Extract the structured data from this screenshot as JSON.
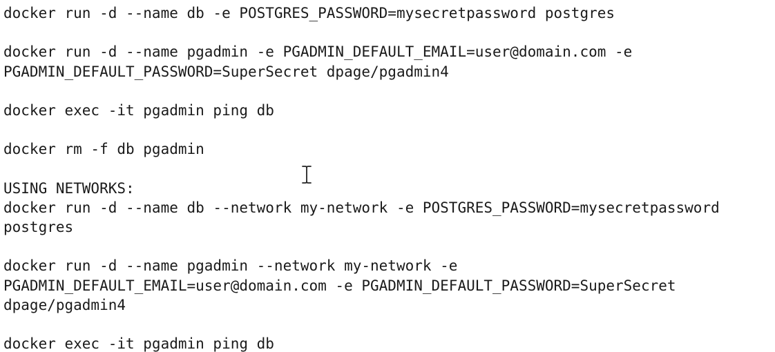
{
  "document": {
    "lines": [
      "docker run -d --name db -e POSTGRES_PASSWORD=mysecretpassword postgres",
      "",
      "docker run -d --name pgadmin -e PGADMIN_DEFAULT_EMAIL=user@domain.com -e",
      "PGADMIN_DEFAULT_PASSWORD=SuperSecret dpage/pgadmin4",
      "",
      "docker exec -it pgadmin ping db",
      "",
      "docker rm -f db pgadmin",
      "",
      "USING NETWORKS:",
      "docker run -d --name db --network my-network -e POSTGRES_PASSWORD=mysecretpassword",
      "postgres",
      "",
      "docker run -d --name pgadmin --network my-network -e",
      "PGADMIN_DEFAULT_EMAIL=user@domain.com -e PGADMIN_DEFAULT_PASSWORD=SuperSecret",
      "dpage/pgadmin4",
      "",
      "docker exec -it pgadmin ping db"
    ]
  },
  "cursor": {
    "icon": "text-cursor-icon"
  }
}
